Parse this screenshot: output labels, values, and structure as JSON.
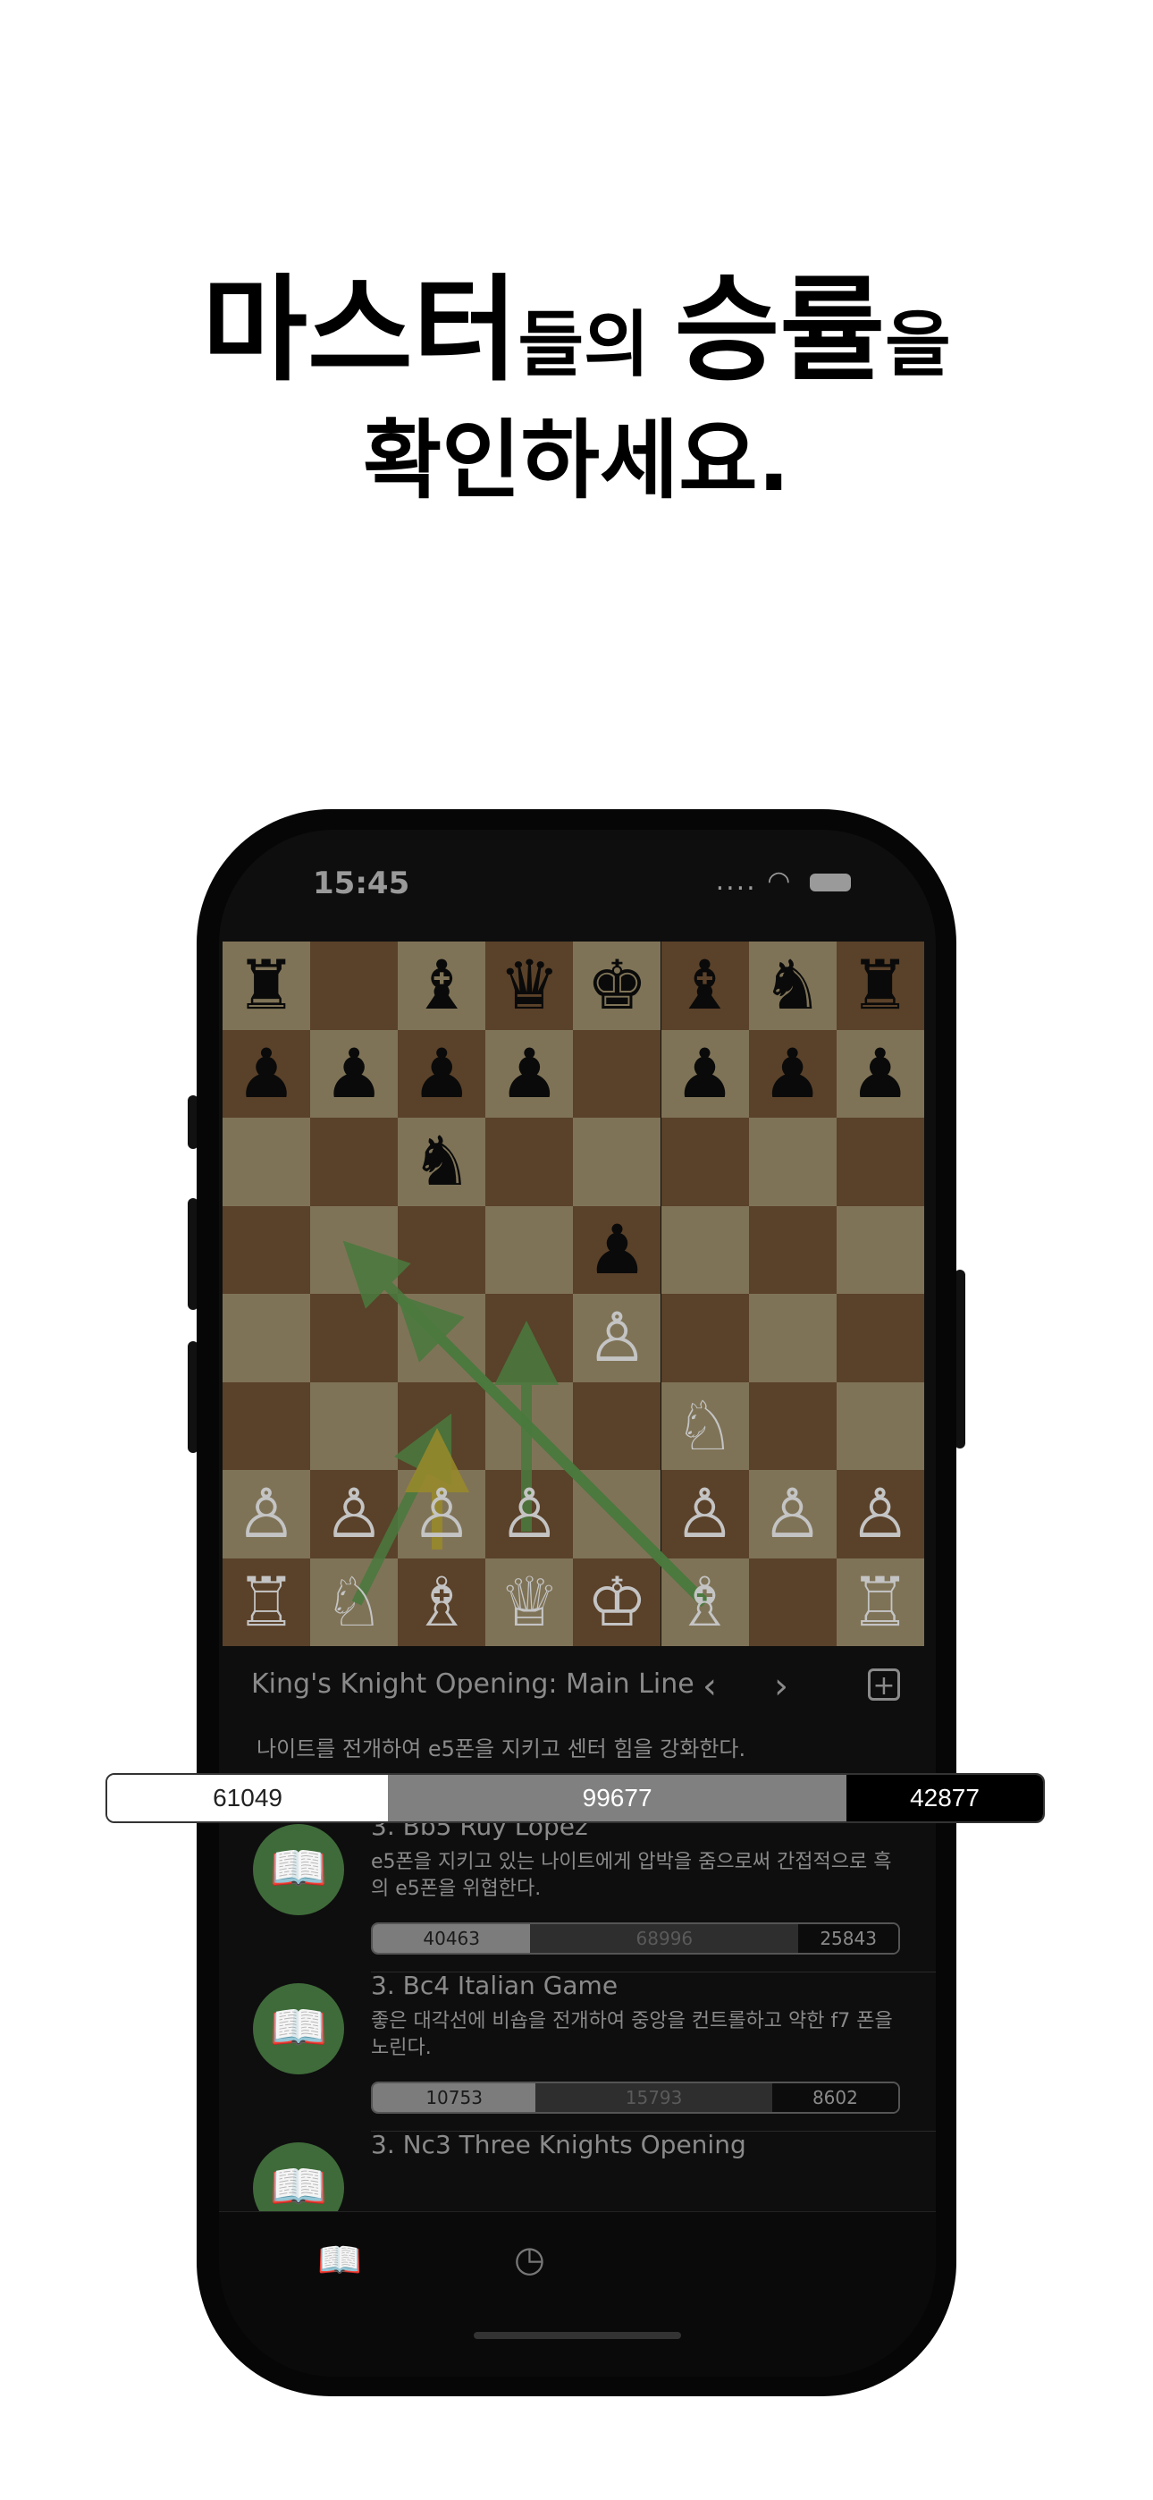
{
  "headline": {
    "line1_part1": "마스터",
    "line1_part2": "들의 ",
    "line1_part3": "승률",
    "line1_part4": "을",
    "line2": "확인하세요."
  },
  "status_bar": {
    "time": "15:45",
    "signal": "....",
    "wifi": "wifi-icon"
  },
  "board": {
    "ranks": [
      [
        "♜",
        "",
        "♝",
        "♛",
        "♚",
        "♝",
        "♞",
        "♜"
      ],
      [
        "♟",
        "♟",
        "♟",
        "♟",
        "",
        "♟",
        "♟",
        "♟"
      ],
      [
        "",
        "",
        "♞",
        "",
        "",
        "",
        "",
        ""
      ],
      [
        "",
        "",
        "",
        "",
        "♟",
        "",
        "",
        ""
      ],
      [
        "",
        "",
        "",
        "",
        "♙",
        "",
        "",
        ""
      ],
      [
        "",
        "",
        "",
        "",
        "",
        "♘",
        "",
        ""
      ],
      [
        "♙",
        "♙",
        "♙",
        "♙",
        "",
        "♙",
        "♙",
        "♙"
      ],
      [
        "♖",
        "♘",
        "♗",
        "♕",
        "♔",
        "♗",
        "",
        "♖"
      ]
    ],
    "colors": [
      [
        "b",
        "",
        "b",
        "b",
        "b",
        "b",
        "b",
        "b"
      ],
      [
        "b",
        "b",
        "b",
        "b",
        "",
        "b",
        "b",
        "b"
      ],
      [
        "",
        "",
        "b",
        "",
        "",
        "",
        "",
        ""
      ],
      [
        "",
        "",
        "",
        "",
        "b",
        "",
        "",
        ""
      ],
      [
        "",
        "",
        "",
        "",
        "w",
        "",
        "",
        ""
      ],
      [
        "",
        "",
        "",
        "",
        "",
        "w",
        "",
        ""
      ],
      [
        "w",
        "w",
        "w",
        "w",
        "",
        "w",
        "w",
        "w"
      ],
      [
        "w",
        "w",
        "w",
        "w",
        "w",
        "w",
        "",
        "w"
      ]
    ]
  },
  "opening": {
    "name": "King's Knight Opening: Main Line",
    "prev": "‹",
    "next": "›",
    "add": "+",
    "description": "나이트를 전개하여 e5폰을 지키고 센터 힘을 강화한다."
  },
  "stats_bar": {
    "white": "61049",
    "draw": "99677",
    "black": "42877",
    "white_frac": 0.3,
    "draw_frac": 0.49,
    "black_frac": 0.21
  },
  "moves": [
    {
      "title": "3. Bb5 Ruy Lopez",
      "desc": "e5폰을 지키고 있는 나이트에게 압박을 줌으로써 간접적으로 흑의 e5폰을 위협한다.",
      "white": "40463",
      "draw": "68996",
      "black": "25843",
      "wf": 0.3,
      "df": 0.51,
      "bf": 0.19
    },
    {
      "title": "3. Bc4 Italian Game",
      "desc": "좋은 대각선에 비숍을 전개하여 중앙을 컨트롤하고 약한 f7 폰을 노린다.",
      "white": "10753",
      "draw": "15793",
      "black": "8602",
      "wf": 0.31,
      "df": 0.45,
      "bf": 0.24
    },
    {
      "title": "3. Nc3 Three Knights Opening",
      "desc": "",
      "white": "",
      "draw": "",
      "black": "",
      "wf": 0.33,
      "df": 0.34,
      "bf": 0.33
    }
  ],
  "tabbar": {
    "left_icon": "book-icon",
    "right_icon": "clock-icon"
  }
}
